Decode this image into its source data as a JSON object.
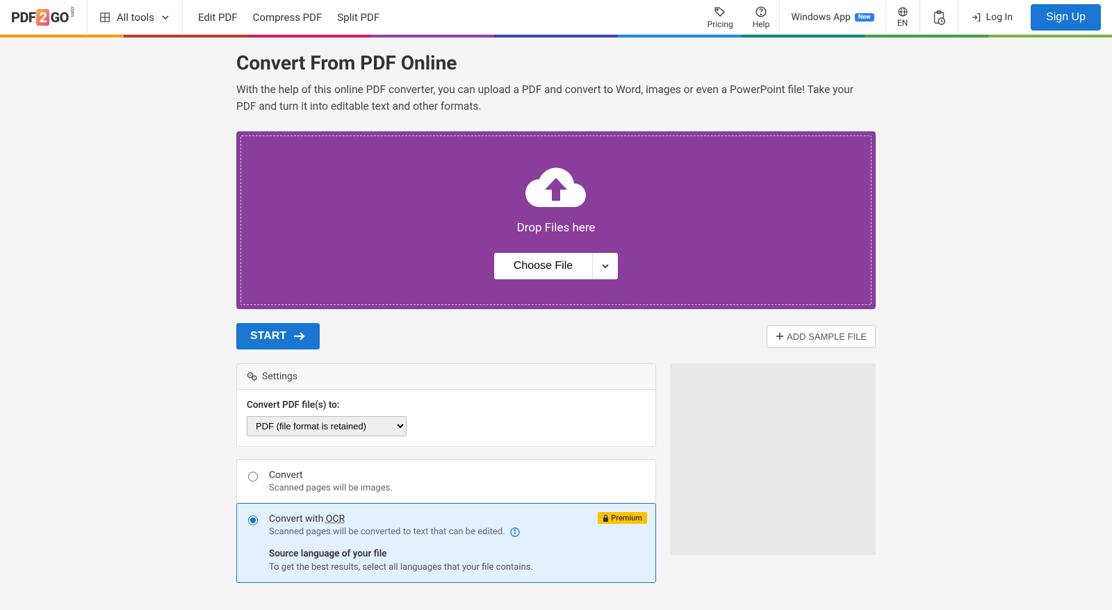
{
  "header": {
    "logo": {
      "p1": "PDF",
      "n2": "2",
      "go": "GO",
      "dot": ".com"
    },
    "all_tools": "All tools",
    "nav": {
      "edit": "Edit PDF",
      "compress": "Compress PDF",
      "split": "Split PDF"
    },
    "pricing": "Pricing",
    "help": "Help",
    "windows_app": "Windows App",
    "new_badge": "New",
    "lang": "EN",
    "login": "Log In",
    "signup": "Sign Up"
  },
  "rainbow": [
    "#f39c12",
    "#c0392b",
    "#d81b60",
    "#8e44ad",
    "#3949ab",
    "#1e88e5",
    "#00897b",
    "#43a047",
    "#7cb342"
  ],
  "page": {
    "title": "Convert From PDF Online",
    "subtitle": "With the help of this online PDF converter, you can upload a PDF and convert to Word, images or even a PowerPoint file! Take your PDF and turn it into editable text and other formats."
  },
  "dropzone": {
    "text": "Drop Files here",
    "choose": "Choose File"
  },
  "actions": {
    "start": "START",
    "add_sample": "ADD SAMPLE FILE"
  },
  "settings": {
    "header": "Settings",
    "convert_to_label": "Convert PDF file(s) to:",
    "convert_to_value": "PDF (file format is retained)"
  },
  "options": {
    "convert": {
      "title": "Convert",
      "desc": "Scanned pages will be images."
    },
    "ocr": {
      "title_pre": "Convert with ",
      "abbr": "OCR",
      "desc": "Scanned pages will be converted to text that can be edited.",
      "premium": "Premium",
      "src_title": "Source language of your file",
      "src_desc": "To get the best results, select all languages that your file contains."
    }
  }
}
